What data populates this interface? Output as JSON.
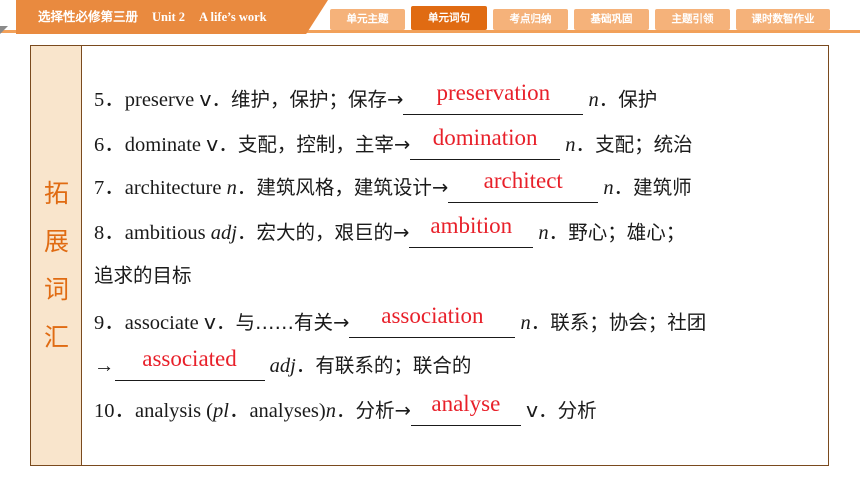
{
  "header": {
    "book": "选择性必修第三册",
    "unit": "Unit 2",
    "unit_title": "A life’s work"
  },
  "tabs": [
    {
      "label": "单元主题",
      "active": false
    },
    {
      "label": "单元词句",
      "active": true
    },
    {
      "label": "考点归纳",
      "active": false
    },
    {
      "label": "基础巩固",
      "active": false
    },
    {
      "label": "主题引领",
      "active": false
    },
    {
      "label": "课时数智作业",
      "active": false
    }
  ],
  "sidebar": {
    "chars": [
      "拓",
      "展",
      "词",
      "汇"
    ]
  },
  "items": [
    {
      "num": "5．",
      "word": "preserve",
      "pos": "v",
      "meaning": "维护，保护；保存→",
      "answer": "preservation",
      "target_pos": "n",
      "target_meaning": "保护"
    },
    {
      "num": "6．",
      "word": "dominate",
      "pos": "v",
      "meaning": "支配，控制，主宰→",
      "answer": "domination",
      "target_pos": "n",
      "target_meaning": "支配；统治"
    },
    {
      "num": "7．",
      "word": "architecture",
      "pos": "n",
      "meaning": "建筑风格，建筑设计→",
      "answer": "architect",
      "target_pos": "n",
      "target_meaning": "建筑师"
    },
    {
      "num": "8．",
      "word": "ambitious",
      "pos": "adj",
      "meaning": "宏大的，艰巨的→",
      "answer": "ambition",
      "target_pos": "n",
      "target_meaning": "野心；雄心；",
      "continuation": "追求的目标"
    },
    {
      "num": "9．",
      "word": "associate",
      "pos": "v",
      "meaning": "与……有关→",
      "answer": "association",
      "target_pos": "n",
      "target_meaning": "联系；协会；社团",
      "second_arrow": "→",
      "second_answer": "associated",
      "second_pos": "adj",
      "second_meaning": "有联系的；联合的"
    },
    {
      "num": "10．",
      "word": "analysis",
      "plural_label": "pl",
      "plural_form": "analyses",
      "pos": "n",
      "meaning": "分析→",
      "answer": "analyse",
      "target_pos": "v",
      "target_meaning": "分析"
    }
  ]
}
